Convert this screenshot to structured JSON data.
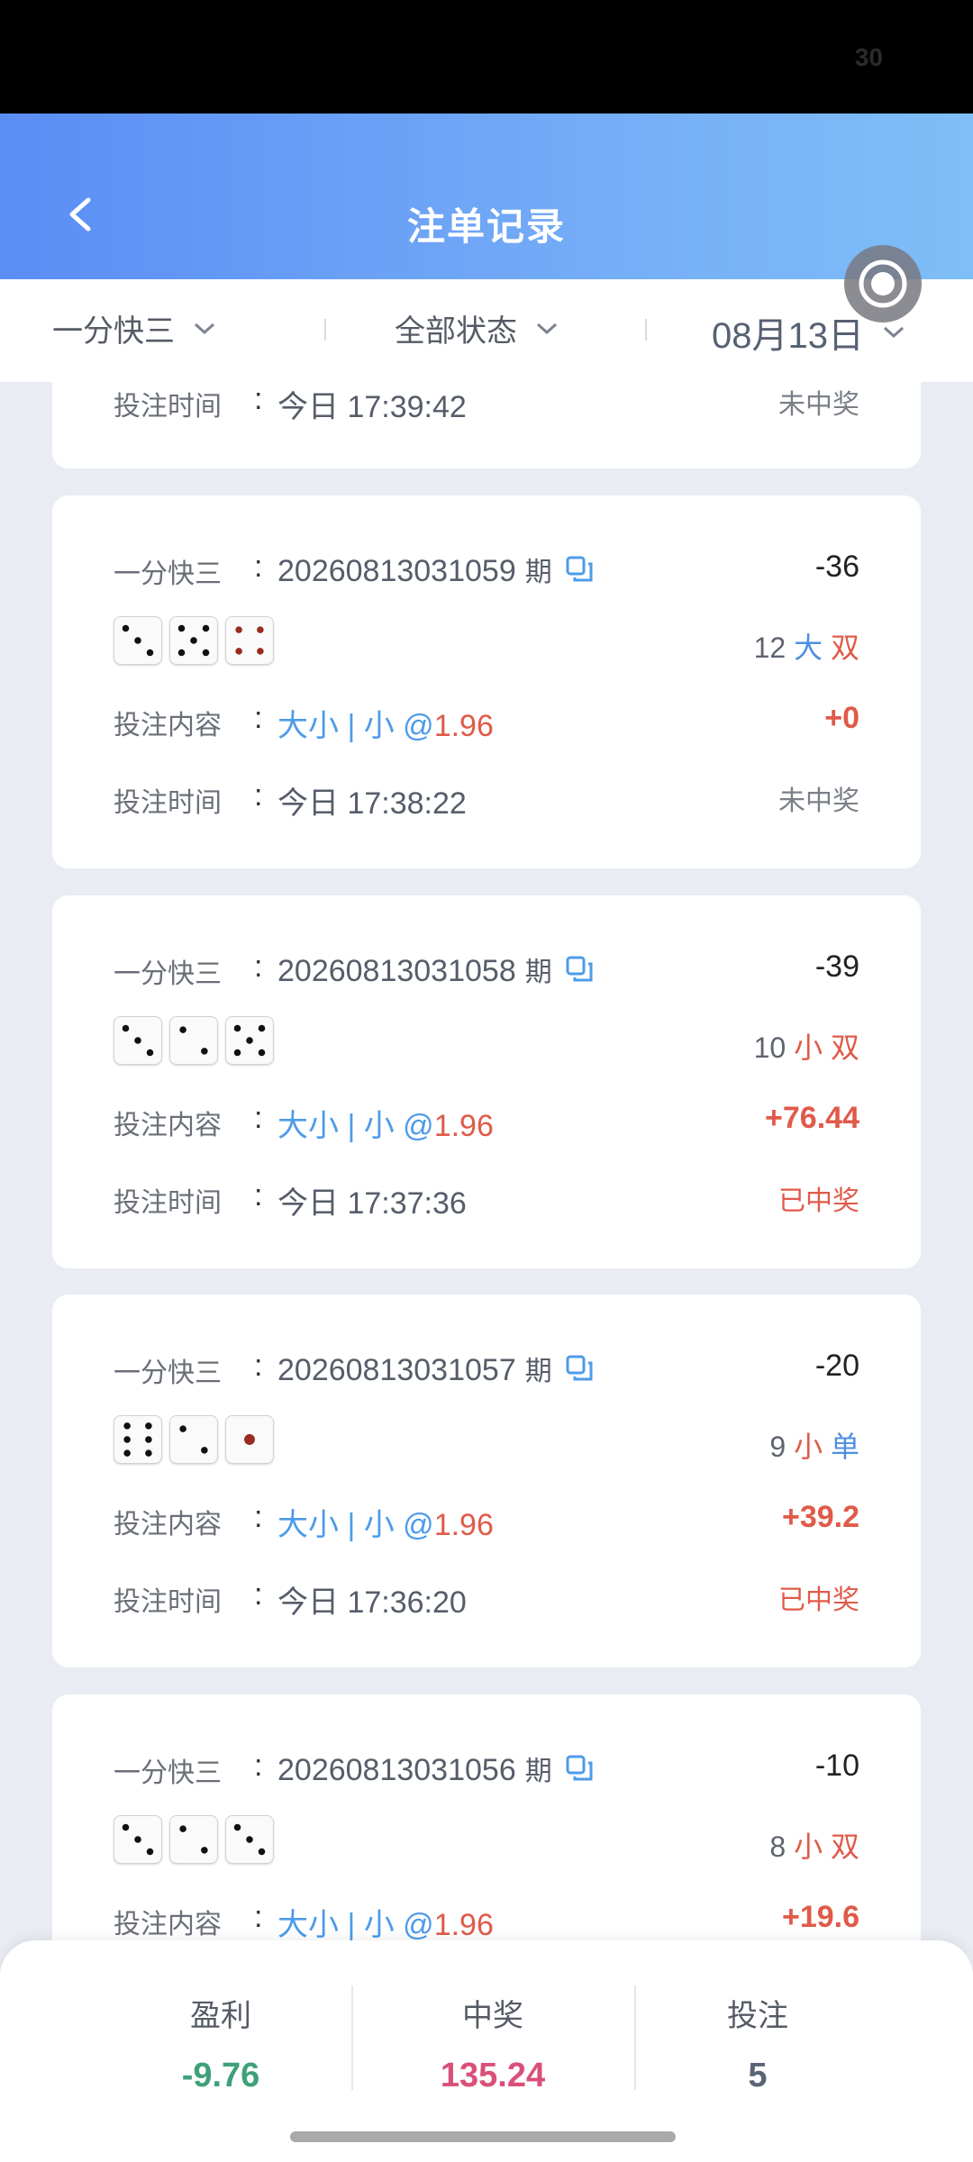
{
  "status_bar": {
    "battery": "30"
  },
  "header": {
    "title": "注单记录"
  },
  "filters": {
    "game": "一分快三",
    "status": "全部状态",
    "date": "08月13日"
  },
  "prev_card": {
    "time_label": "投注时间",
    "time": "今日 17:39:42",
    "status": "未中奖"
  },
  "cards": [
    {
      "game": "一分快三",
      "issue": "20260813031059",
      "period": "期",
      "amount": "-36",
      "dice": [
        3,
        5,
        4
      ],
      "sum": "12",
      "size": "大",
      "parity": "双",
      "content_label": "投注内容",
      "content_type": "大小",
      "content_pick": "小",
      "odds": "1.96",
      "payout": "+0",
      "time_label": "投注时间",
      "time": "今日 17:38:22",
      "status": "未中奖"
    },
    {
      "game": "一分快三",
      "issue": "20260813031058",
      "period": "期",
      "amount": "-39",
      "dice": [
        3,
        2,
        5
      ],
      "sum": "10",
      "size": "小",
      "parity": "双",
      "content_label": "投注内容",
      "content_type": "大小",
      "content_pick": "小",
      "odds": "1.96",
      "payout": "+76.44",
      "time_label": "投注时间",
      "time": "今日 17:37:36",
      "status": "已中奖"
    },
    {
      "game": "一分快三",
      "issue": "20260813031057",
      "period": "期",
      "amount": "-20",
      "dice": [
        6,
        2,
        1
      ],
      "sum": "9",
      "size": "小",
      "parity": "单",
      "content_label": "投注内容",
      "content_type": "大小",
      "content_pick": "小",
      "odds": "1.96",
      "payout": "+39.2",
      "time_label": "投注时间",
      "time": "今日 17:36:20",
      "status": "已中奖"
    },
    {
      "game": "一分快三",
      "issue": "20260813031056",
      "period": "期",
      "amount": "-10",
      "dice": [
        3,
        2,
        3
      ],
      "sum": "8",
      "size": "小",
      "parity": "双",
      "content_label": "投注内容",
      "content_type": "大小",
      "content_pick": "小",
      "odds": "1.96",
      "payout": "+19.6"
    }
  ],
  "summary": {
    "profit_label": "盈利",
    "profit": "-9.76",
    "win_label": "中奖",
    "win": "135.24",
    "bets_label": "投注",
    "bets": "5"
  },
  "colors": {
    "profit": "#3fa07a",
    "win": "#d9507a",
    "bets": "#5b6474",
    "accent_red": "#e05a49",
    "accent_blue": "#4d9be8"
  }
}
